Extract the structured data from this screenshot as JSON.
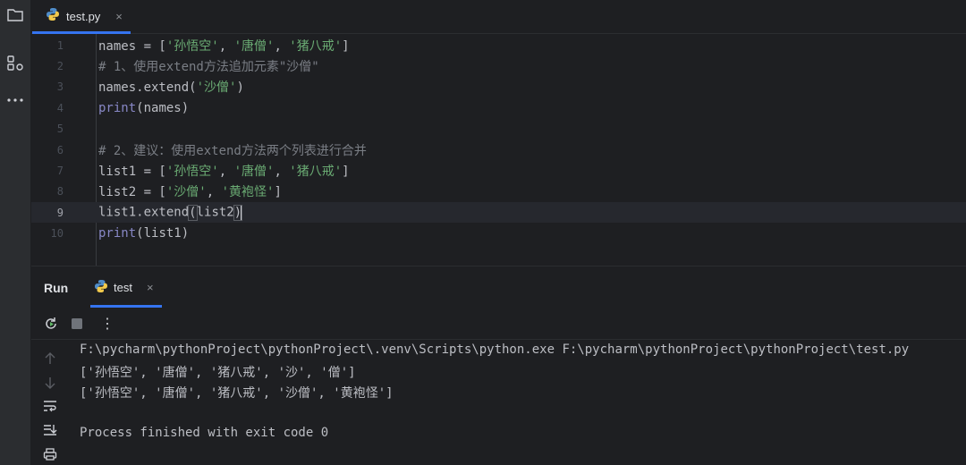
{
  "toolstrip": {
    "icons": [
      "folder-icon",
      "structure-icon",
      "more-icon"
    ]
  },
  "editor_tab": {
    "file_name": "test.py",
    "close_glyph": "×"
  },
  "editor": {
    "current_line": 9,
    "lines": [
      {
        "number": "1",
        "tokens": [
          {
            "t": "names = [",
            "c": ""
          },
          {
            "t": "'孙悟空'",
            "c": "str"
          },
          {
            "t": ", ",
            "c": ""
          },
          {
            "t": "'唐僧'",
            "c": "str"
          },
          {
            "t": ", ",
            "c": ""
          },
          {
            "t": "'猪八戒'",
            "c": "str"
          },
          {
            "t": "]",
            "c": ""
          }
        ]
      },
      {
        "number": "2",
        "tokens": [
          {
            "t": "# 1、使用extend方法追加元素\"沙僧\"",
            "c": "cmt"
          }
        ]
      },
      {
        "number": "3",
        "tokens": [
          {
            "t": "names.extend(",
            "c": ""
          },
          {
            "t": "'沙僧'",
            "c": "str"
          },
          {
            "t": ")",
            "c": ""
          }
        ]
      },
      {
        "number": "4",
        "tokens": [
          {
            "t": "print",
            "c": "bi"
          },
          {
            "t": "(names)",
            "c": ""
          }
        ]
      },
      {
        "number": "5",
        "tokens": []
      },
      {
        "number": "6",
        "tokens": [
          {
            "t": "# 2、建议：使用extend方法两个列表进行合并",
            "c": "cmt"
          }
        ]
      },
      {
        "number": "7",
        "tokens": [
          {
            "t": "list1 = [",
            "c": ""
          },
          {
            "t": "'孙悟空'",
            "c": "str"
          },
          {
            "t": ", ",
            "c": ""
          },
          {
            "t": "'唐僧'",
            "c": "str"
          },
          {
            "t": ", ",
            "c": ""
          },
          {
            "t": "'猪八戒'",
            "c": "str"
          },
          {
            "t": "]",
            "c": ""
          }
        ]
      },
      {
        "number": "8",
        "tokens": [
          {
            "t": "list2 = [",
            "c": ""
          },
          {
            "t": "'沙僧'",
            "c": "str"
          },
          {
            "t": ", ",
            "c": ""
          },
          {
            "t": "'黄袍怪'",
            "c": "str"
          },
          {
            "t": "]",
            "c": ""
          }
        ]
      },
      {
        "number": "9",
        "tokens": [
          {
            "t": "list1.extend",
            "c": ""
          },
          {
            "t": "(",
            "c": "box"
          },
          {
            "t": "list2",
            "c": ""
          },
          {
            "t": ")",
            "c": "box"
          },
          {
            "t": "",
            "c": "caret"
          }
        ]
      },
      {
        "number": "10",
        "tokens": [
          {
            "t": "print",
            "c": "bi"
          },
          {
            "t": "(list1)",
            "c": ""
          }
        ]
      }
    ]
  },
  "run_panel": {
    "title": "Run",
    "tab_label": "test",
    "close_glyph": "×",
    "more_glyph": "⋮"
  },
  "console": {
    "lines": [
      "F:\\pycharm\\pythonProject\\pythonProject\\.venv\\Scripts\\python.exe F:\\pycharm\\pythonProject\\pythonProject\\test.py",
      "['孙悟空', '唐僧', '猪八戒', '沙', '僧']",
      "['孙悟空', '唐僧', '猪八戒', '沙僧', '黄袍怪']",
      "",
      "Process finished with exit code 0"
    ]
  },
  "colors": {
    "background": "#1e1f22",
    "accent": "#3574f0",
    "string": "#6aab73",
    "comment": "#7a7e85",
    "builtin": "#8888c6",
    "text": "#bcbec4"
  }
}
